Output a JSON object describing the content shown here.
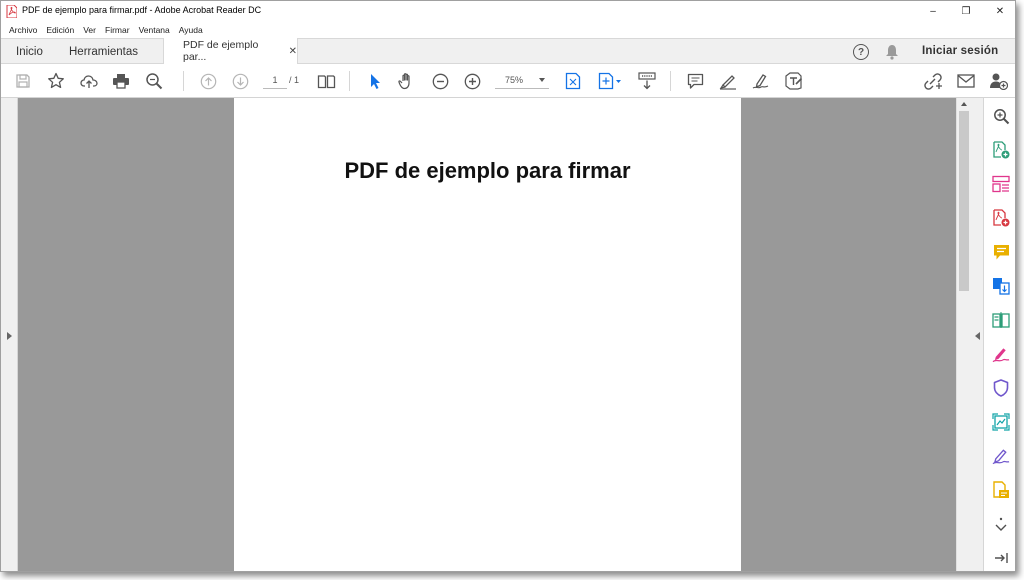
{
  "window": {
    "title": "PDF de ejemplo para firmar.pdf - Adobe Acrobat Reader DC",
    "controls": {
      "minimize": "–",
      "restore": "❐",
      "close": "✕"
    }
  },
  "menu": {
    "items": [
      "Archivo",
      "Edición",
      "Ver",
      "Firmar",
      "Ventana",
      "Ayuda"
    ]
  },
  "tabs": {
    "home": "Inicio",
    "tools": "Herramientas",
    "document": "PDF de ejemplo par...",
    "close_glyph": "✕"
  },
  "header": {
    "help_glyph": "?",
    "sign_in": "Iniciar sesión"
  },
  "toolbar": {
    "page_current": "1",
    "page_total": "/ 1",
    "zoom": "75%",
    "icons": [
      "save-icon",
      "bookmark-star-icon",
      "upload-cloud-icon",
      "print-icon",
      "search-zoom-icon",
      "page-up-icon",
      "page-down-icon",
      "page-layout-icon",
      "select-cursor-icon",
      "hand-icon",
      "zoom-out-icon",
      "zoom-in-icon",
      "fit-page-icon",
      "rotate-view-icon",
      "scroll-mode-icon",
      "comment-icon",
      "highlight-pen-icon",
      "fill-sign-icon",
      "edit-text-icon",
      "share-link-icon",
      "email-icon",
      "add-person-icon"
    ]
  },
  "document": {
    "heading": "PDF de ejemplo para firmar"
  },
  "rail": {
    "icons": [
      "search-zoom-icon",
      "create-pdf-icon",
      "organize-pages-icon",
      "export-pdf-icon",
      "comment-icon",
      "combine-files-icon",
      "compare-icon",
      "fill-sign-icon",
      "protect-shield-icon",
      "scan-icon",
      "sign-pen-icon",
      "send-for-review-icon",
      "more-tools-icon",
      "collapse-panel-icon"
    ],
    "colors": {
      "blue": "#1473e6",
      "teal": "#12a3a8",
      "pink": "#e0368c",
      "red": "#d7373f",
      "yellow": "#e9b000",
      "green": "#2d9d78",
      "purple": "#7057cc",
      "gray": "#505050"
    }
  }
}
